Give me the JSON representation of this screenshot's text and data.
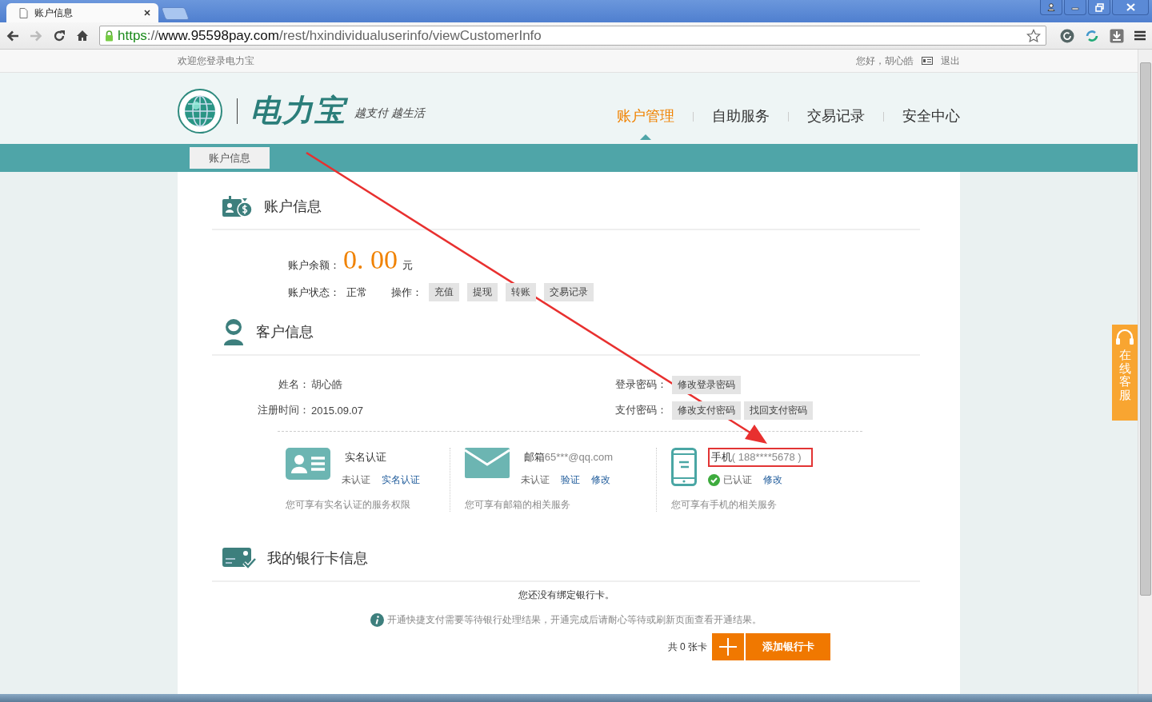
{
  "browser": {
    "tab_title": "账户信息",
    "url": {
      "scheme": "https",
      "separator": "://",
      "host": "www.95598pay.com",
      "path": "/rest/hxindividualuserinfo/viewCustomerInfo"
    }
  },
  "top_bar": {
    "welcome": "欢迎您登录电力宝",
    "greeting": "您好，胡心皓",
    "logout": "退出"
  },
  "header": {
    "brand": "电力宝",
    "slogan": "越支付 越生活",
    "nav": [
      {
        "label": "账户管理",
        "selected": true
      },
      {
        "label": "自助服务",
        "selected": false
      },
      {
        "label": "交易记录",
        "selected": false
      },
      {
        "label": "安全中心",
        "selected": false
      }
    ]
  },
  "subnav": [
    {
      "label": "账户信息",
      "selected": true
    }
  ],
  "account": {
    "title": "账户信息",
    "balance_label": "账户余额：",
    "balance": "0. 00",
    "currency": "元",
    "status_label": "账户状态：",
    "status": "正常",
    "ops_label": "操作：",
    "ops": [
      "充值",
      "提现",
      "转账",
      "交易记录"
    ]
  },
  "customer": {
    "title": "客户信息",
    "fields": [
      {
        "label": "姓名：",
        "value": "胡心皓"
      },
      {
        "label": "注册时间：",
        "value": "2015.09.07"
      }
    ],
    "passwords": [
      {
        "label": "登录密码：",
        "buttons": [
          "修改登录密码"
        ]
      },
      {
        "label": "支付密码：",
        "buttons": [
          "修改支付密码",
          "找回支付密码"
        ]
      }
    ]
  },
  "verifications": [
    {
      "kind": "id",
      "title": "实名认证",
      "verified": false,
      "status": "未认证",
      "links": [
        "实名认证"
      ],
      "note": "您可享有实名认证的服务权限",
      "highlighted": false
    },
    {
      "kind": "email",
      "title": "邮箱",
      "detail": "65***@qq.com",
      "verified": false,
      "status": "未认证",
      "links": [
        "验证",
        "修改"
      ],
      "note": "您可享有邮箱的相关服务",
      "highlighted": false
    },
    {
      "kind": "phone",
      "title": "手机",
      "detail": "( 188****5678 )",
      "verified": true,
      "status": "已认证",
      "links": [
        "修改"
      ],
      "note": "您可享有手机的相关服务",
      "highlighted": true
    }
  ],
  "bank": {
    "title": "我的银行卡信息",
    "empty_message": "您还没有绑定银行卡。",
    "info": "开通快捷支付需要等待银行处理结果，开通完成后请耐心等待或刷新页面查看开通结果。",
    "count": "共 0 张卡",
    "add_button": "添加银行卡"
  },
  "side_service": {
    "label": "在线客服"
  }
}
